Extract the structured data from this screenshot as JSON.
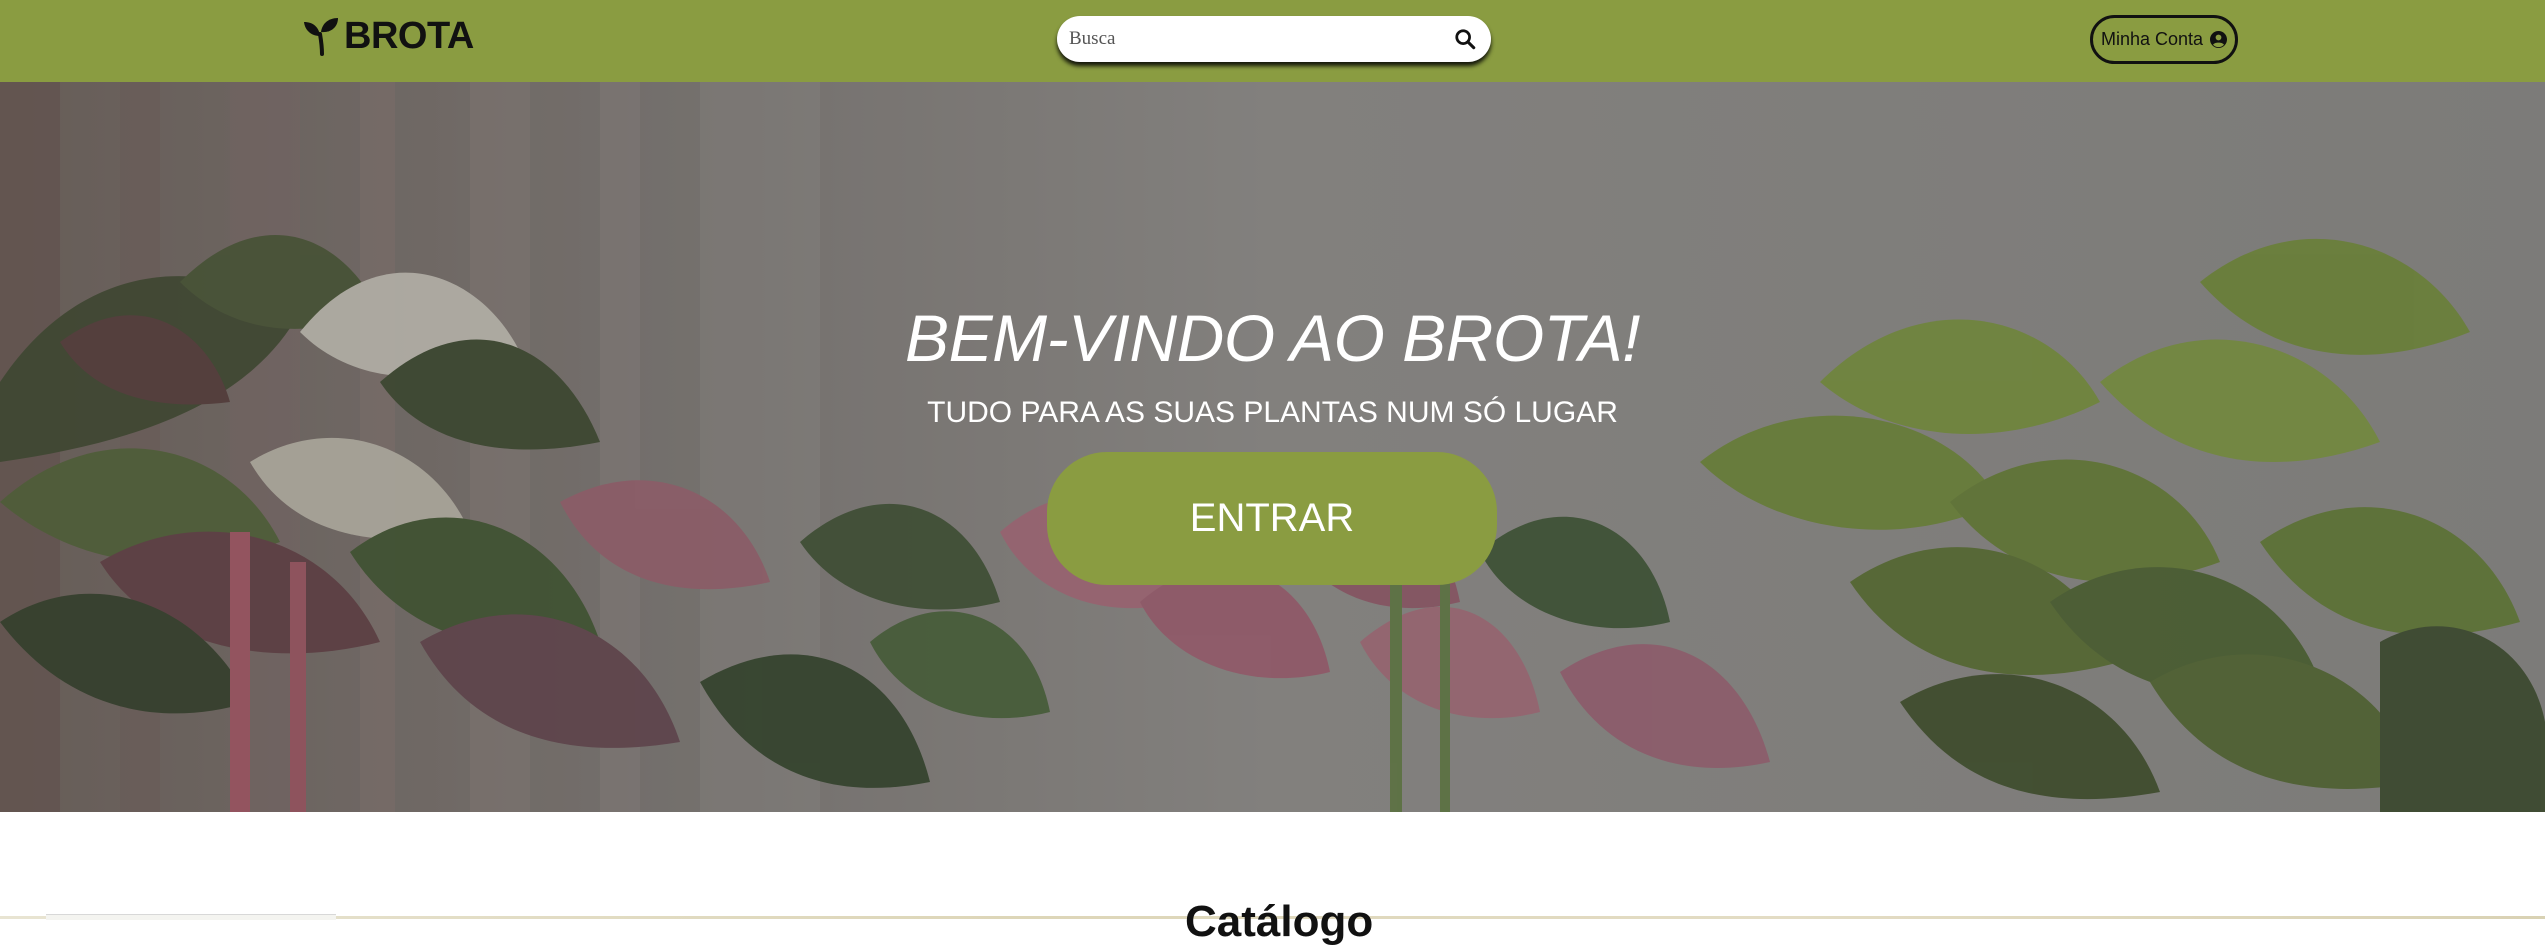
{
  "header": {
    "logo_text": "BROTA",
    "search": {
      "placeholder": "Busca",
      "value": ""
    },
    "account_label": "Minha Conta"
  },
  "hero": {
    "title": "BEM-VINDO AO BROTA!",
    "subtitle": "TUDO PARA AS SUAS PLANTAS NUM SÓ LUGAR",
    "button_label": "ENTRAR"
  },
  "section": {
    "heading": "Catálogo"
  },
  "icons": {
    "logo": "sprout-icon",
    "search": "search-icon",
    "account": "user-circle-icon"
  },
  "colors": {
    "brand_green": "#8a9c41",
    "text_dark": "#111111",
    "white": "#ffffff"
  }
}
